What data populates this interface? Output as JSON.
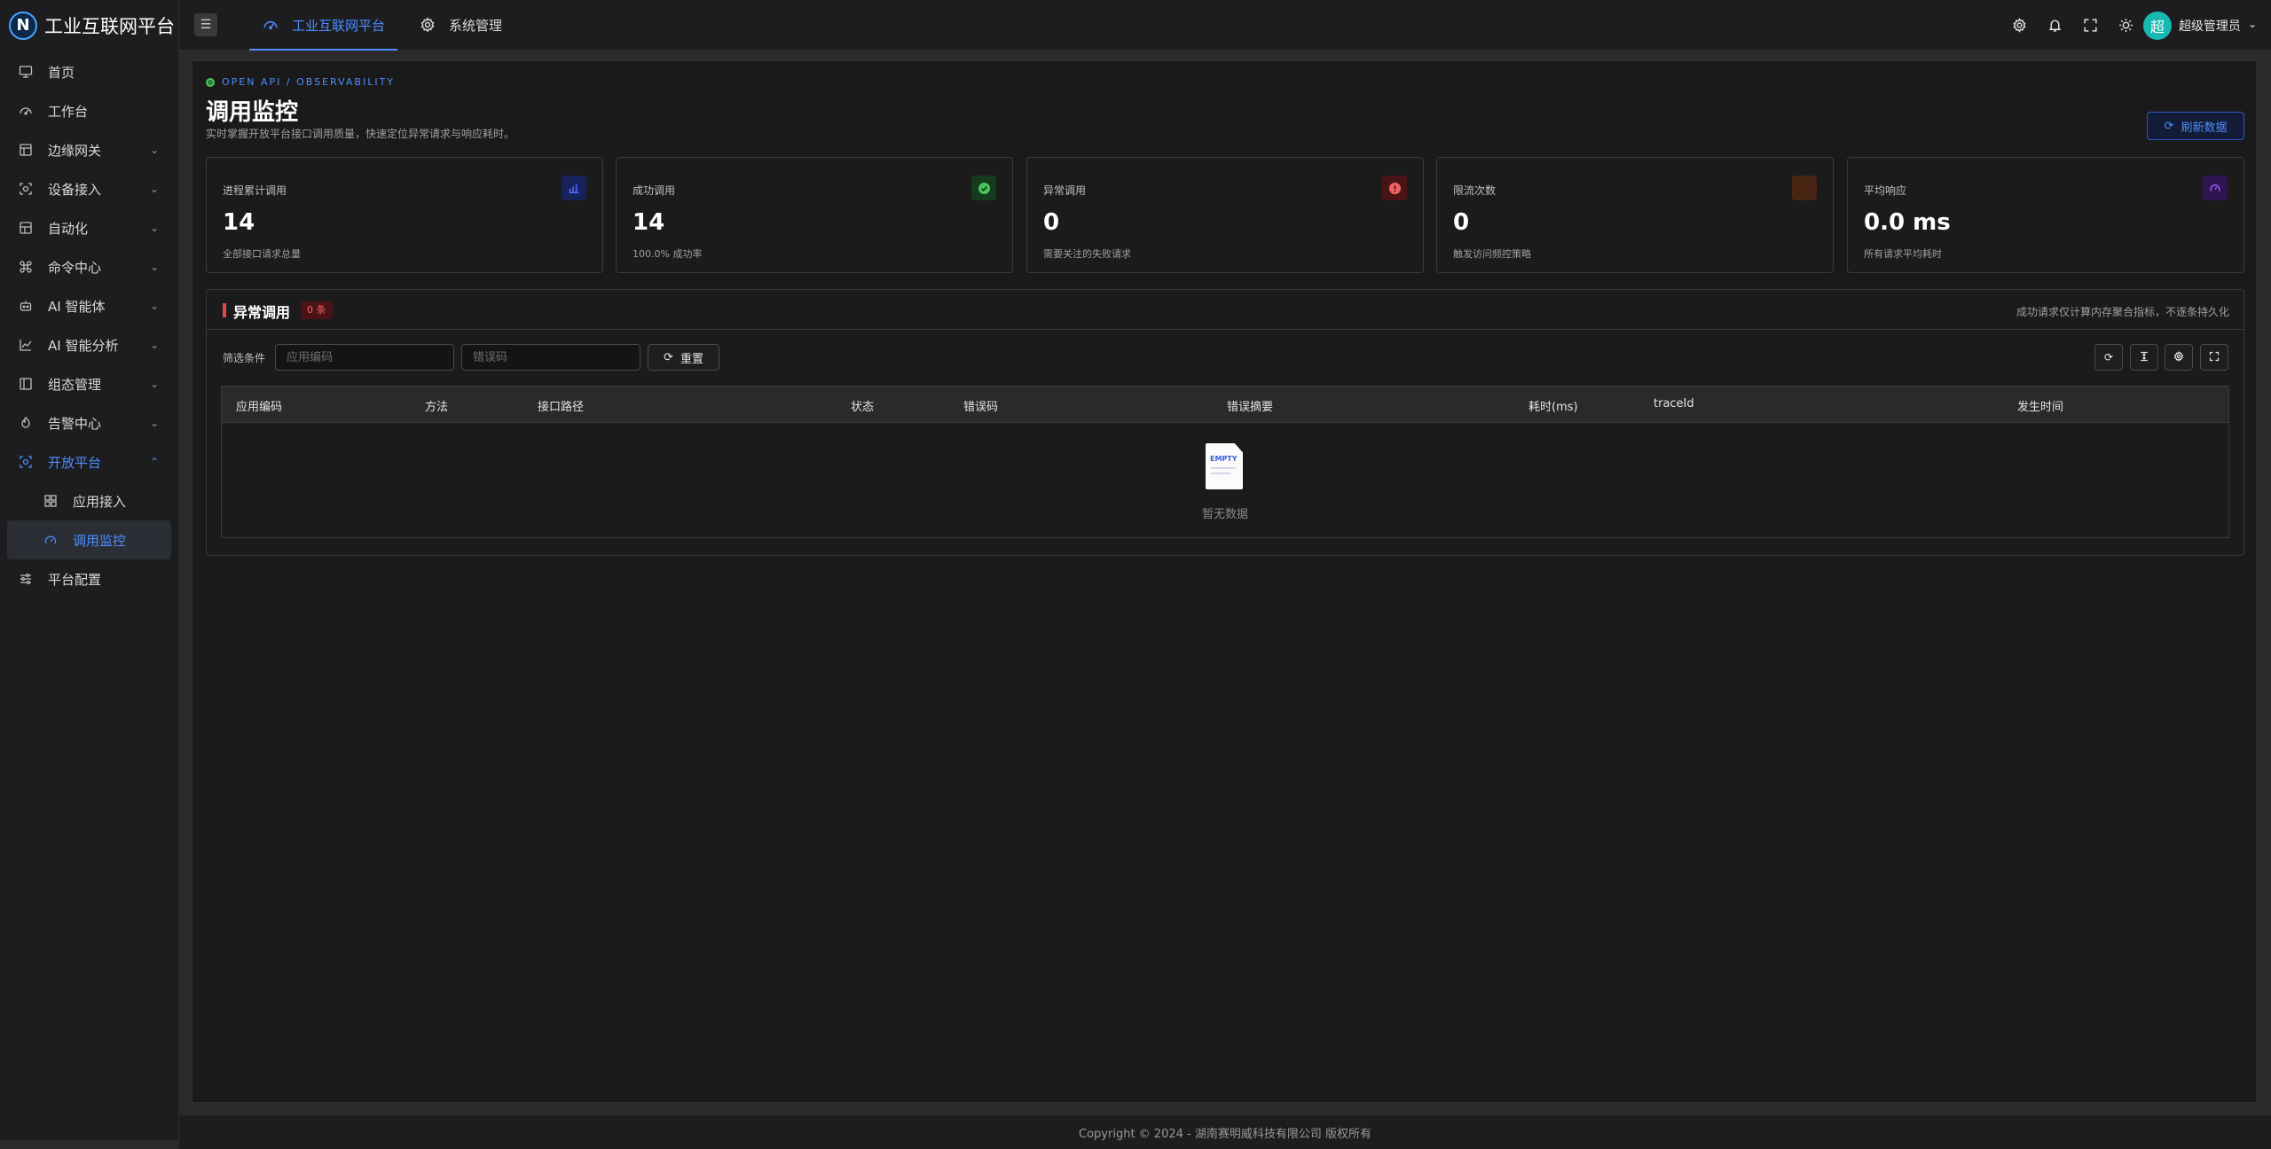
{
  "brand": {
    "name": "工业互联网平台",
    "logo_letter": "N"
  },
  "sidebar": {
    "items": [
      {
        "label": "首页",
        "icon": "monitor-icon"
      },
      {
        "label": "工作台",
        "icon": "dashboard-icon"
      },
      {
        "label": "边缘网关",
        "icon": "gateway-icon",
        "expandable": true
      },
      {
        "label": "设备接入",
        "icon": "device-icon",
        "expandable": true
      },
      {
        "label": "自动化",
        "icon": "automation-icon",
        "expandable": true
      },
      {
        "label": "命令中心",
        "icon": "command-icon",
        "expandable": true
      },
      {
        "label": "AI 智能体",
        "icon": "robot-icon",
        "expandable": true
      },
      {
        "label": "AI 智能分析",
        "icon": "chart-line-icon",
        "expandable": true
      },
      {
        "label": "组态管理",
        "icon": "layout-icon",
        "expandable": true
      },
      {
        "label": "告警中心",
        "icon": "alarm-icon",
        "expandable": true
      },
      {
        "label": "开放平台",
        "icon": "open-platform-icon",
        "expandable": true,
        "open": true
      },
      {
        "label": "平台配置",
        "icon": "sliders-icon"
      }
    ],
    "sub_items": [
      {
        "label": "应用接入",
        "icon": "grid-icon"
      },
      {
        "label": "调用监控",
        "icon": "gauge-icon",
        "active": true
      }
    ]
  },
  "header": {
    "tabs": [
      {
        "label": "工业互联网平台",
        "icon": "dashboard-icon",
        "active": true
      },
      {
        "label": "系统管理",
        "icon": "gear-icon"
      }
    ],
    "user": {
      "avatar": "超",
      "name": "超级管理员"
    }
  },
  "page": {
    "eyebrow": "OPEN API / OBSERVABILITY",
    "title": "调用监控",
    "description": "实时掌握开放平台接口调用质量，快速定位异常请求与响应耗时。",
    "refresh_label": "刷新数据"
  },
  "stats": [
    {
      "label": "进程累计调用",
      "value": "14",
      "sub": "全部接口请求总量",
      "icon": "bar-chart-icon",
      "color": "#4d6bff",
      "bg": "#17215a"
    },
    {
      "label": "成功调用",
      "value": "14",
      "sub": "100.0% 成功率",
      "icon": "check-circle-icon",
      "color": "#4ac25a",
      "bg": "#163a1e"
    },
    {
      "label": "异常调用",
      "value": "0",
      "sub": "需要关注的失败请求",
      "icon": "alert-circle-icon",
      "color": "#f06363",
      "bg": "#4a1416"
    },
    {
      "label": "限流次数",
      "value": "0",
      "sub": "触发访问频控策略",
      "icon": "throttle-icon",
      "color": "#d0703a",
      "bg": "#4a2412"
    },
    {
      "label": "平均响应",
      "value": "0.0 ms",
      "sub": "所有请求平均耗时",
      "icon": "gauge-icon",
      "color": "#a55cff",
      "bg": "#2e1650"
    }
  ],
  "panel": {
    "title": "异常调用",
    "badge": "0 条",
    "note": "成功请求仅计算内存聚合指标，不逐条持久化",
    "filter_label": "筛选条件",
    "app_code_placeholder": "应用编码",
    "error_code_placeholder": "错误码",
    "reset_label": "重置",
    "columns": [
      "应用编码",
      "方法",
      "接口路径",
      "状态",
      "错误码",
      "错误摘要",
      "耗时(ms)",
      "traceId",
      "发生时间"
    ],
    "empty_text": "暂无数据",
    "empty_image_text": "EMPTY"
  },
  "footer": "Copyright © 2024 - 湖南赛明威科技有限公司 版权所有"
}
